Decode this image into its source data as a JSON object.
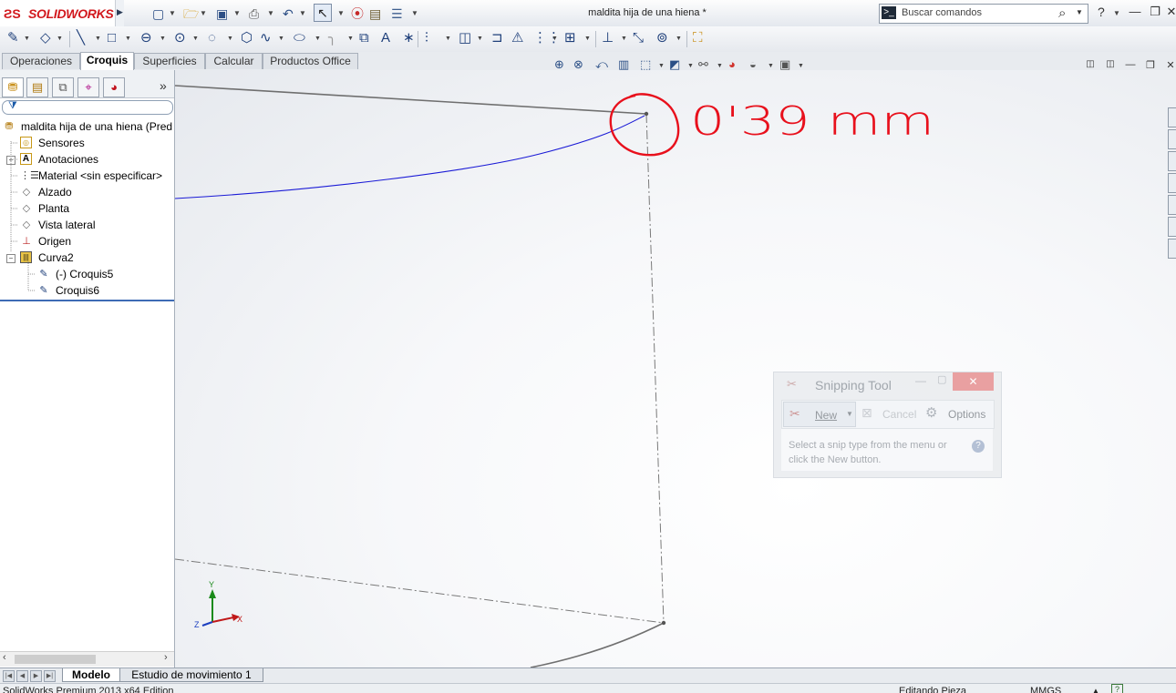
{
  "app": {
    "logo": "SOLIDWORKS",
    "document_title": "maldita hija de una hiena *",
    "search_placeholder": "Buscar comandos",
    "help": "?"
  },
  "command_tabs": [
    "Operaciones",
    "Croquis",
    "Superficies",
    "Calcular",
    "Productos Office"
  ],
  "active_command_tab": "Croquis",
  "feature_tree": {
    "root": "maldita hija de una hiena  (Pred",
    "items": [
      {
        "label": "Sensores",
        "icon": "sensor-icon"
      },
      {
        "label": "Anotaciones",
        "icon": "annotation-icon"
      },
      {
        "label": "Material <sin especificar>",
        "icon": "material-icon"
      },
      {
        "label": "Alzado",
        "icon": "plane-icon"
      },
      {
        "label": "Planta",
        "icon": "plane-icon"
      },
      {
        "label": "Vista lateral",
        "icon": "plane-icon"
      },
      {
        "label": "Origen",
        "icon": "origin-icon"
      },
      {
        "label": "Curva2",
        "icon": "curve-icon"
      },
      {
        "label": "(-) Croquis5",
        "icon": "sketch-icon"
      },
      {
        "label": "Croquis6",
        "icon": "sketch-icon"
      }
    ]
  },
  "annotation": {
    "handwritten": "0'39 mm",
    "color": "#e8101c"
  },
  "snipping_tool": {
    "title": "Snipping Tool",
    "new_label": "New",
    "cancel_label": "Cancel",
    "options_label": "Options",
    "message": "Select a snip type from the menu or click the New button."
  },
  "triad": {
    "y": "Y",
    "x": "X",
    "z": "Z"
  },
  "bottom_tabs": [
    "Modelo",
    "Estudio de movimiento 1"
  ],
  "active_bottom_tab": "Modelo",
  "status": {
    "edition": "SolidWorks Premium 2013 x64 Edition",
    "mode": "Editando Pieza",
    "units": "MMGS"
  },
  "colors": {
    "brand": "#d2181d",
    "sketch_blue": "#1a1ad6",
    "edge_gray": "#6f6f6f",
    "tree_separator": "#3e6bb5"
  }
}
